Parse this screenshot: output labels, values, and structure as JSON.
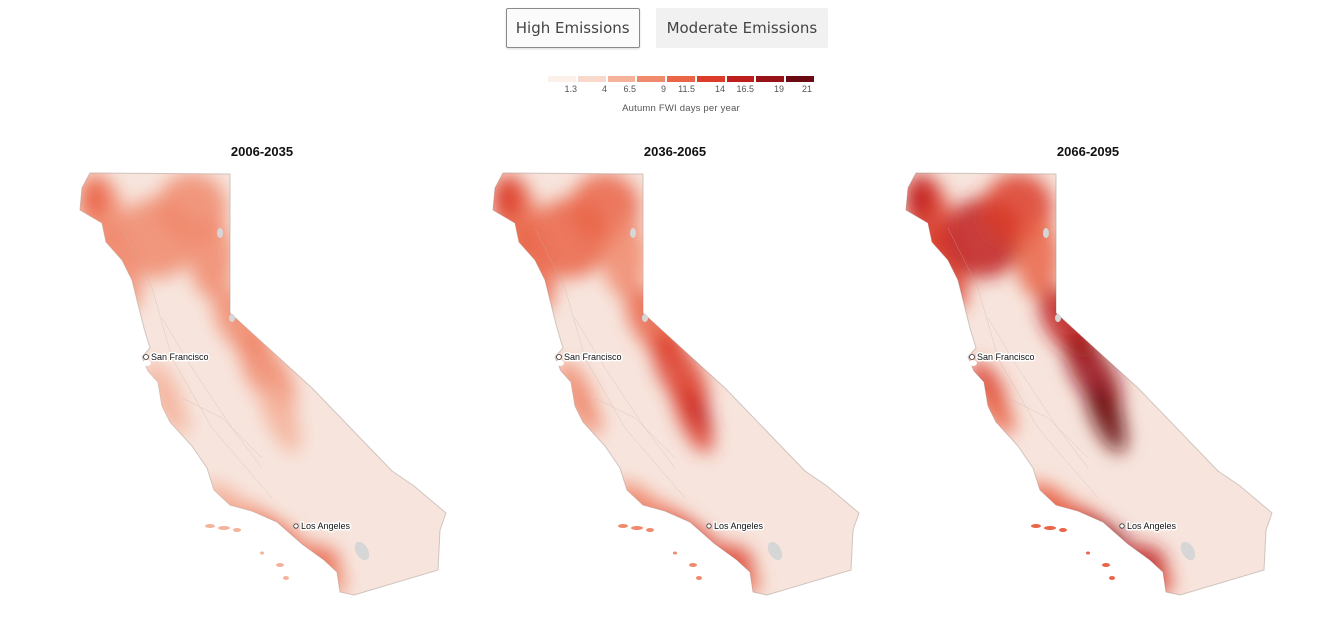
{
  "scenario_toggle": {
    "options": [
      {
        "label": "High Emissions",
        "active": true
      },
      {
        "label": "Moderate Emissions",
        "active": false
      }
    ]
  },
  "legend": {
    "title": "Autumn FWI days per year",
    "ticks": [
      "1.3",
      "4",
      "6.5",
      "9",
      "11.5",
      "14",
      "16.5",
      "19",
      "21"
    ],
    "colors": [
      "#fbf0ea",
      "#f9d9cb",
      "#f5b39b",
      "#f08a6d",
      "#ea6548",
      "#dc3c2a",
      "#bf1e1f",
      "#971318",
      "#6b0a12"
    ]
  },
  "maps": [
    {
      "title": "2006-2035",
      "intensity": 1
    },
    {
      "title": "2036-2065",
      "intensity": 2
    },
    {
      "title": "2066-2095",
      "intensity": 3
    }
  ],
  "cities": {
    "sf": "San Francisco",
    "la": "Los Angeles"
  },
  "colors": {
    "state_base": "#f7e5dd",
    "state_outline": "#d0c4be",
    "water": "#d6d6d6"
  }
}
